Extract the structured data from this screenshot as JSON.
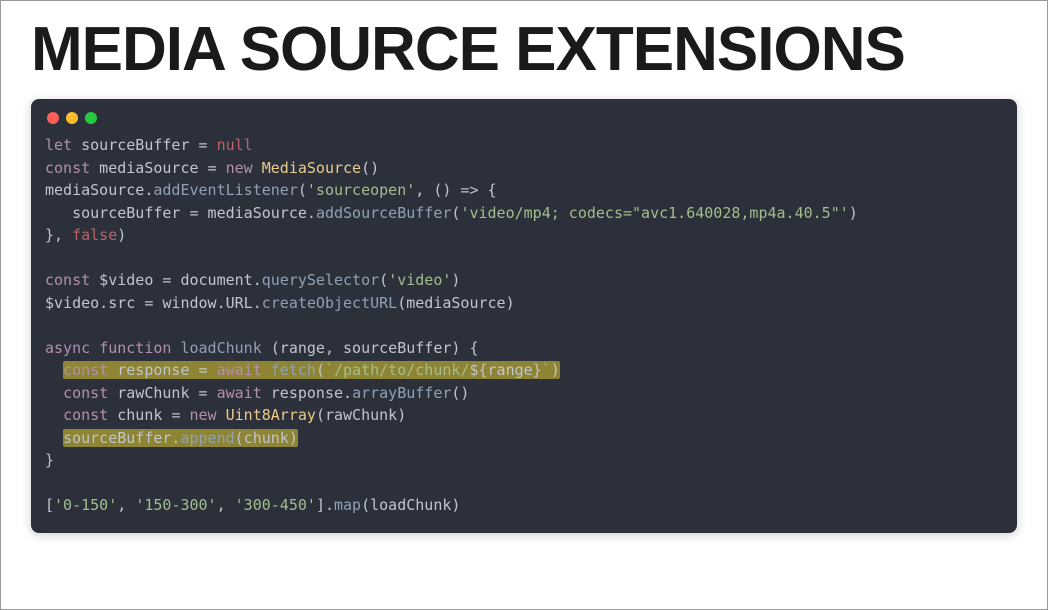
{
  "heading": "MEDIA SOURCE EXTENSIONS",
  "window": {
    "traffic": [
      "red",
      "yellow",
      "green"
    ]
  },
  "code": {
    "l1_kw_let": "let",
    "l1_id": " sourceBuffer ",
    "l1_op": "= ",
    "l1_null": "null",
    "l2_kw_const": "const",
    "l2_id": " mediaSource ",
    "l2_op": "= ",
    "l2_new": "new",
    "l2_cls": " MediaSource",
    "l2_paren": "()",
    "l3_obj": "mediaSource.",
    "l3_call": "addEventListener",
    "l3_open": "(",
    "l3_str": "'sourceopen'",
    "l3_rest": ", () => {",
    "l4_indent": "   ",
    "l4_lhs": "sourceBuffer = mediaSource.",
    "l4_call": "addSourceBuffer",
    "l4_open": "(",
    "l4_str": "'video/mp4; codecs=\"avc1.640028,mp4a.40.5\"'",
    "l4_close": ")",
    "l5_close": "}, ",
    "l5_false": "false",
    "l5_par": ")",
    "blank": "",
    "l7_kw": "const",
    "l7_id": " $video ",
    "l7_op": "= ",
    "l7_obj": "document.",
    "l7_call": "querySelector",
    "l7_open": "(",
    "l7_str": "'video'",
    "l7_close": ")",
    "l8_lhs": "$video.src = window.URL.",
    "l8_call": "createObjectURL",
    "l8_open": "(",
    "l8_arg": "mediaSource",
    "l8_close": ")",
    "l10_async": "async ",
    "l10_func": "function ",
    "l10_name": "loadChunk ",
    "l10_sig": "(range, sourceBuffer) {",
    "l11_ind": "  ",
    "l11_kw": "const",
    "l11_id": " response ",
    "l11_op": "= ",
    "l11_aw": "await ",
    "l11_fn": "fetch",
    "l11_open": "(",
    "l11_tpl_a": "`/path/to/chunk/",
    "l11_tpl_expr": "${range}",
    "l11_tpl_b": "`",
    "l11_close": ")",
    "l12_ind": "  ",
    "l12_kw": "const",
    "l12_id": " rawChunk ",
    "l12_op": "= ",
    "l12_aw": "await",
    "l12_rhs": " response.",
    "l12_fn": "arrayBuffer",
    "l12_par": "()",
    "l13_ind": "  ",
    "l13_kw": "const",
    "l13_id": " chunk ",
    "l13_op": "= ",
    "l13_new": "new ",
    "l13_cls": "Uint8Array",
    "l13_par": "(rawChunk)",
    "l14_ind": "  ",
    "l14_obj": "sourceBuffer.",
    "l14_fn": "append",
    "l14_par": "(chunk)",
    "l15_close": "}",
    "l17_open": "[",
    "l17_s1": "'0-150'",
    "l17_c1": ", ",
    "l17_s2": "'150-300'",
    "l17_c2": ", ",
    "l17_s3": "'300-450'",
    "l17_close": "].",
    "l17_fn": "map",
    "l17_par": "(loadChunk)"
  }
}
